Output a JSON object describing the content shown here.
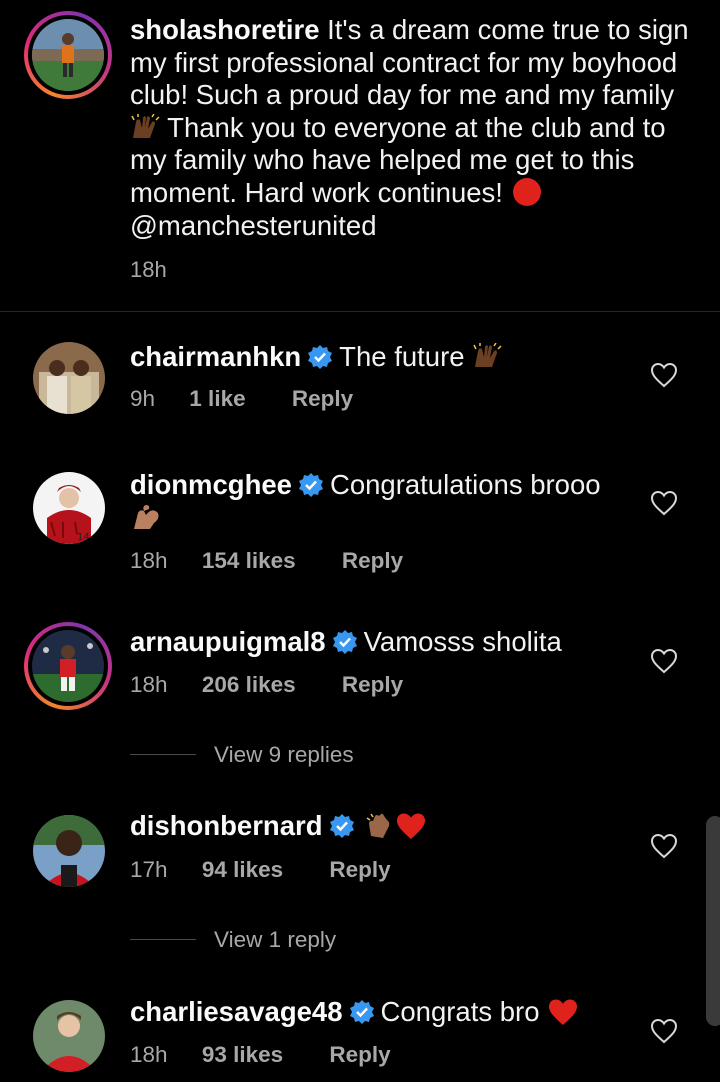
{
  "caption": {
    "username": "sholashoretire",
    "text_part1": " It's a dream come true to sign my first professional contract for my boyhood club! Such a proud day for me and my family ",
    "text_part2": " Thank you to everyone at the club and to my family who have helped me get to this moment. Hard work continues! ",
    "mention": "@manchesterunited",
    "time": "18h"
  },
  "comments": [
    {
      "username": "chairmanhkn",
      "verified": true,
      "text": "The future",
      "time": "9h",
      "likes": "1 like",
      "reply": "Reply"
    },
    {
      "username": "dionmcghee",
      "verified": true,
      "text": "Congratulations brooo",
      "time": "18h",
      "likes": "154 likes",
      "reply": "Reply"
    },
    {
      "username": "arnaupuigmal8",
      "verified": true,
      "text": "Vamosss sholita",
      "time": "18h",
      "likes": "206 likes",
      "reply": "Reply",
      "view_replies": "View 9 replies"
    },
    {
      "username": "dishonbernard",
      "verified": true,
      "text": "",
      "time": "17h",
      "likes": "94 likes",
      "reply": "Reply",
      "view_replies": "View 1 reply"
    },
    {
      "username": "charliesavage48",
      "verified": true,
      "text": "Congrats bro",
      "time": "18h",
      "likes": "93 likes",
      "reply": "Reply"
    }
  ],
  "colors": {
    "background": "#000000",
    "text": "#f2f2f2",
    "secondary_text": "#a8a8a8",
    "verified_blue": "#3897f0",
    "heart_red": "#e0221d"
  },
  "icons": [
    "raising-hands-emoji",
    "red-circle-emoji",
    "verified-badge-icon",
    "heart-outline-icon",
    "flexed-bicep-emoji",
    "clapping-hands-emoji",
    "red-heart-emoji"
  ]
}
